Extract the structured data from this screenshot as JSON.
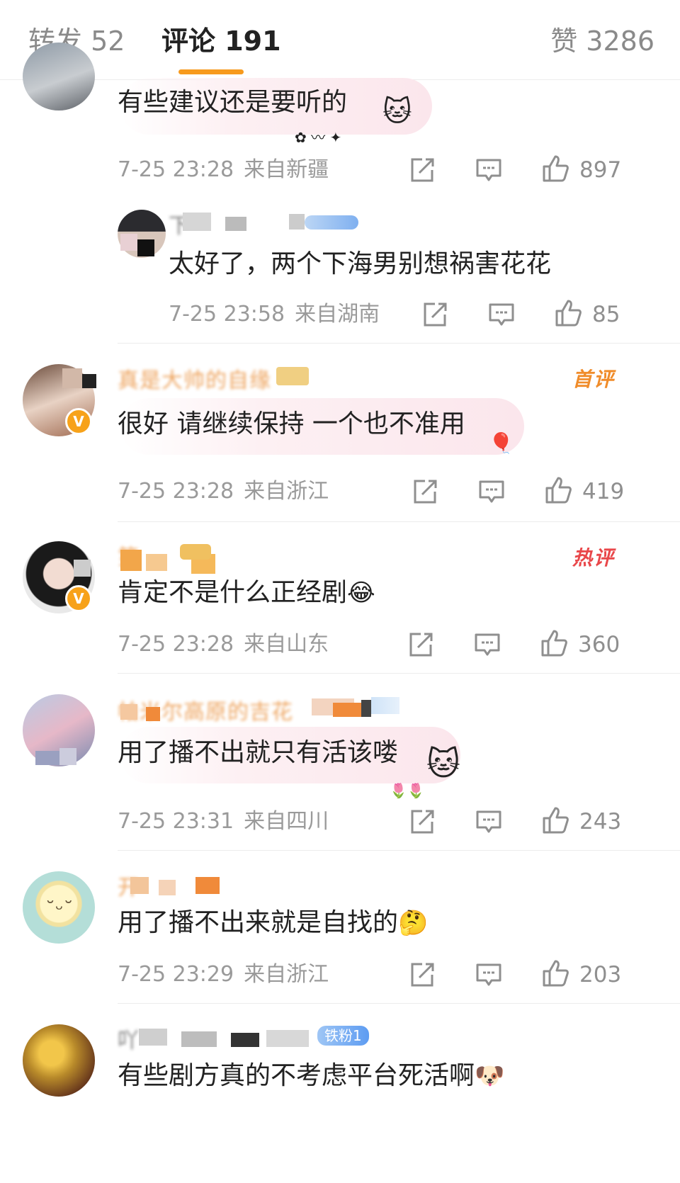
{
  "tabs": {
    "repost": "转发 52",
    "comment": "评论 191",
    "likes": "赞 3286"
  },
  "comments": [
    {
      "text": "有些建议还是要听的",
      "time": "7-25 23:28",
      "location": "来自新疆",
      "likes": "897",
      "reply": {
        "username": "下",
        "text": "太好了，两个下海男别想祸害花花",
        "time": "7-25 23:58",
        "location": "来自湖南",
        "likes": "85"
      }
    },
    {
      "username": "真是大帅的自缘",
      "badge": "首评",
      "text": "很好 请继续保持 一个也不准用",
      "time": "7-25 23:28",
      "location": "来自浙江",
      "likes": "419"
    },
    {
      "username": "第",
      "badge": "热评",
      "text": "肯定不是什么正经剧",
      "time": "7-25 23:28",
      "location": "来自山东",
      "likes": "360"
    },
    {
      "username": "帕米尔高原的吉花",
      "text": "用了播不出就只有活该喽",
      "time": "7-25 23:31",
      "location": "来自四川",
      "likes": "243"
    },
    {
      "username": "开",
      "text": "用了播不出来就是自找的",
      "time": "7-25 23:29",
      "location": "来自浙江",
      "likes": "203"
    },
    {
      "username": "吖",
      "fan_tag": "铁粉1",
      "text": "有些剧方真的不考虑平台死活啊",
      "time": "",
      "location": "",
      "likes": ""
    }
  ],
  "colors": {
    "accent": "#f79a1d",
    "username": "#e8862a",
    "hot": "#e9474a",
    "meta": "#9a9a9a"
  },
  "icons": [
    "share-icon",
    "comment-icon",
    "like-icon"
  ]
}
